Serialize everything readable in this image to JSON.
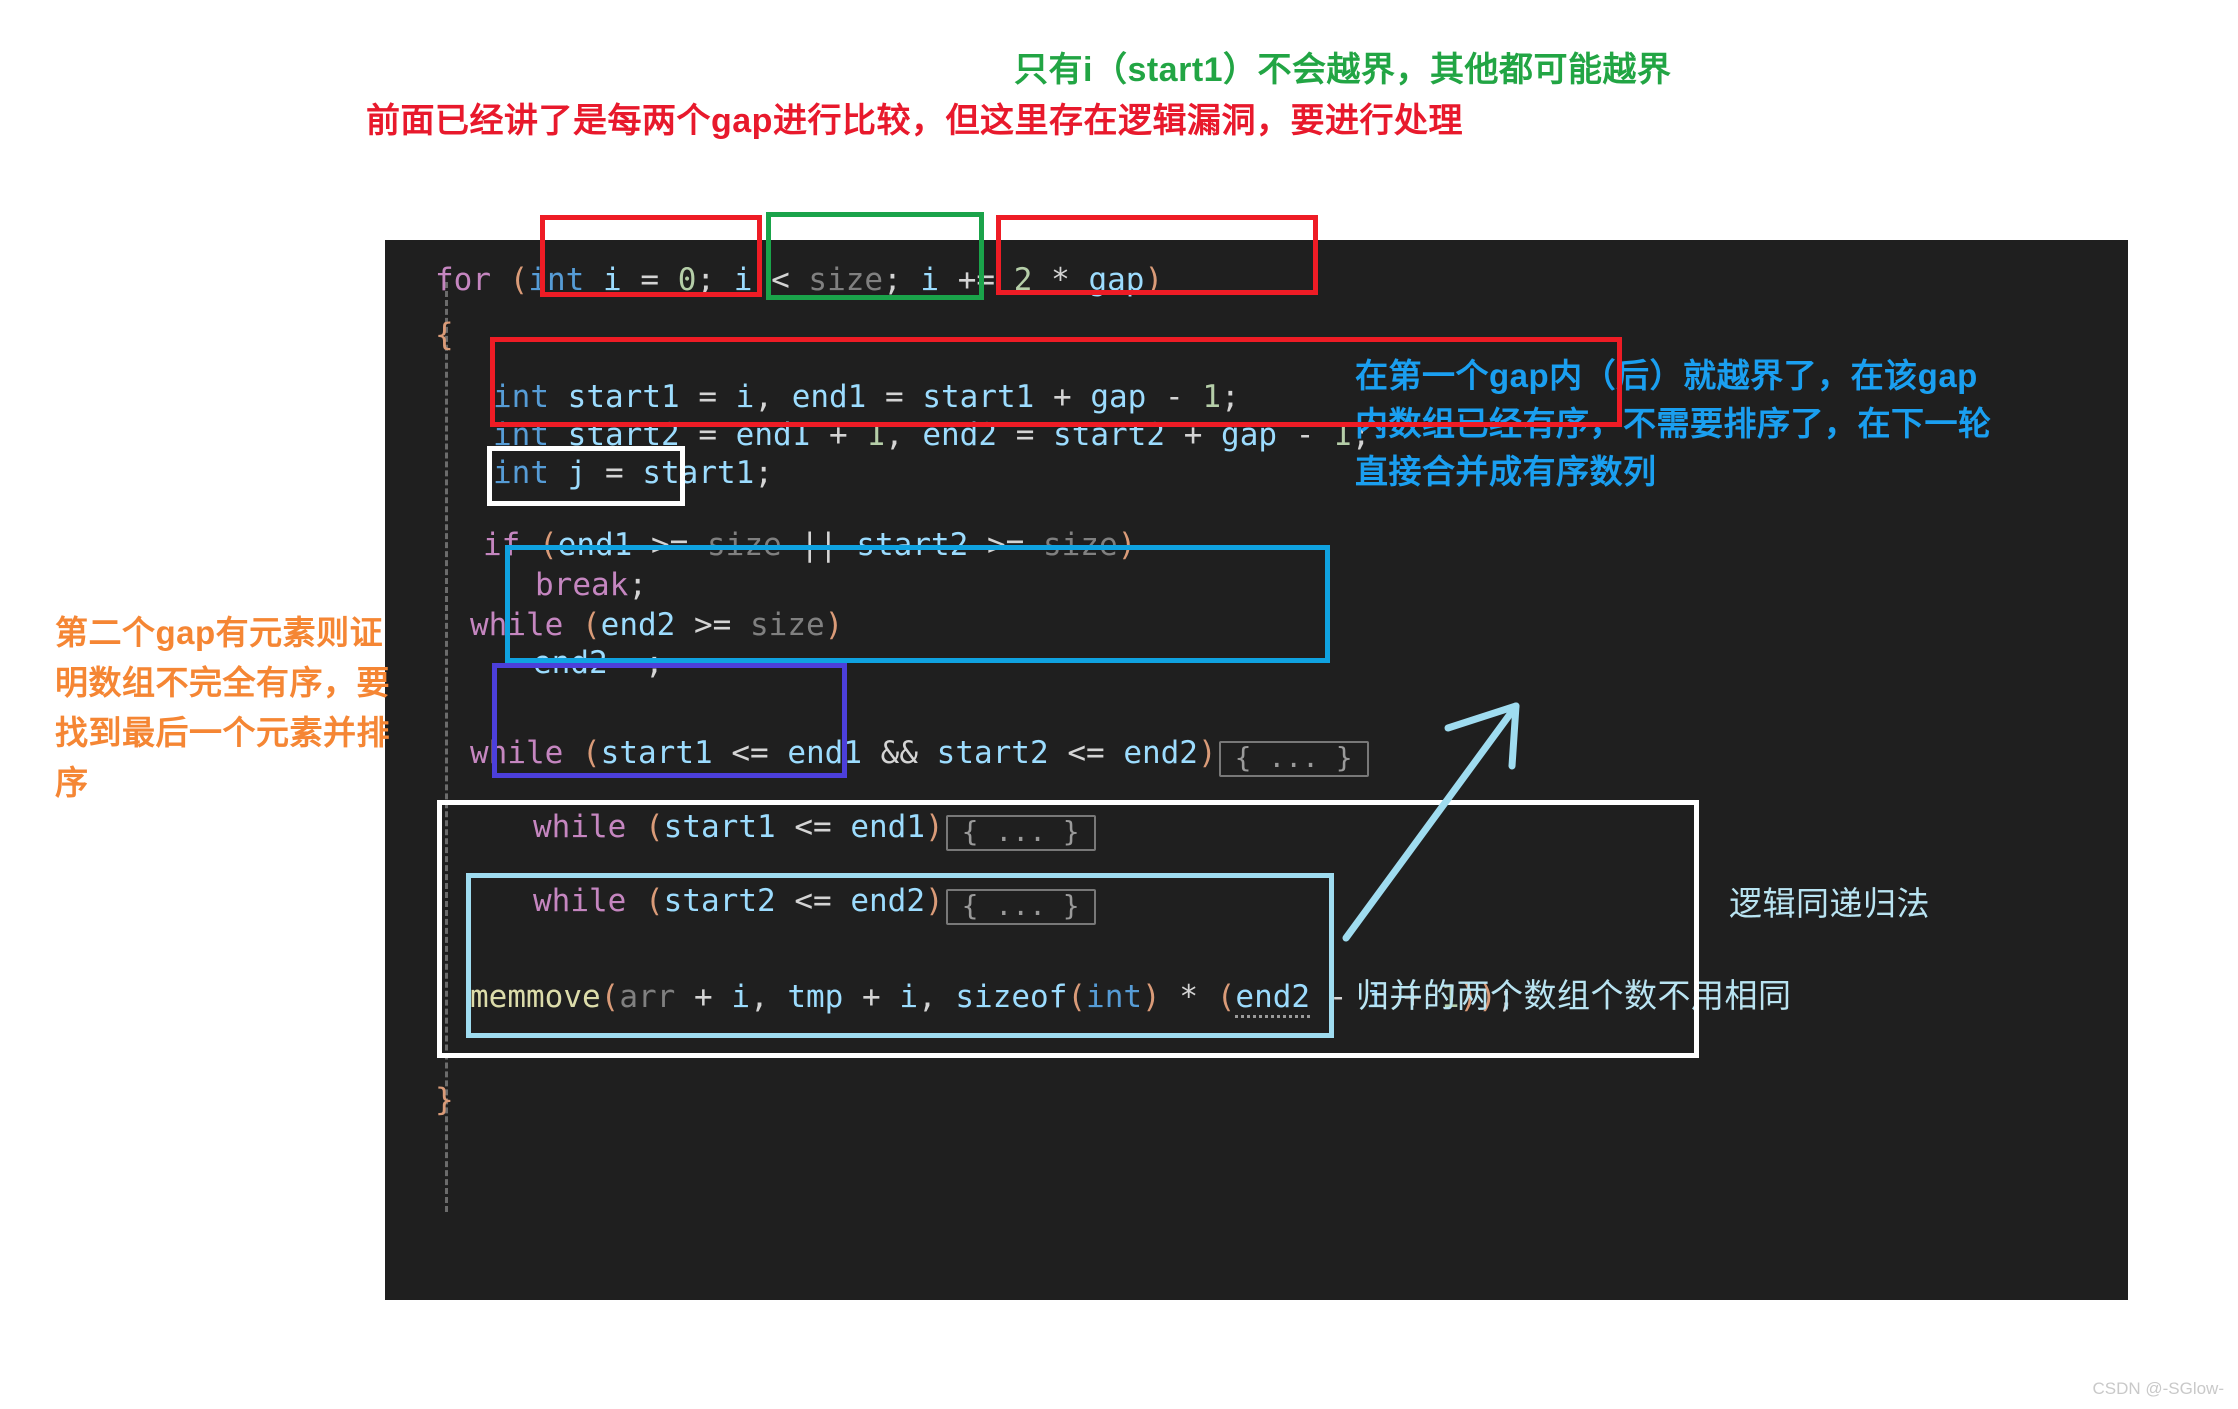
{
  "annotations": {
    "top_green": "只有i（start1）不会越界，其他都可能越界",
    "top_red": "前面已经讲了是每两个gap进行比较，但这里存在逻辑漏洞，要进行处理",
    "left_orange": "第二个gap有元素则证明数组不完全有序，要找到最后一个元素并排序",
    "right_blue": "在第一个gap内（后）就越界了，在该gap内数组已经有序，不需要排序了，在下一轮直接合并成有序数列",
    "right_lightblue_1": "逻辑同递归法",
    "right_lightblue_2": "归并的两个数组个数不用相同"
  },
  "code": {
    "language": "c",
    "lines": [
      {
        "id": "for-header",
        "text": "for (int i = 0; i < size; i += 2 * gap)"
      },
      {
        "id": "open-brace",
        "text": "{"
      },
      {
        "id": "decl-1",
        "text": "int start1 = i, end1 = start1 + gap - 1;"
      },
      {
        "id": "decl-2",
        "text": "int start2 = end1 + 1, end2 = start2 + gap - 1;"
      },
      {
        "id": "decl-j",
        "text": "int j = start1;"
      },
      {
        "id": "if-bound",
        "text": "if (end1 >= size || start2 >= size)"
      },
      {
        "id": "break",
        "text": "break;"
      },
      {
        "id": "while-end2",
        "text": "while (end2 >= size)"
      },
      {
        "id": "end2-dec",
        "text": "end2--;"
      },
      {
        "id": "while-merge",
        "text": "while (start1 <= end1 && start2 <= end2)",
        "fold": "{ ... }"
      },
      {
        "id": "while-rest1",
        "text": "while (start1 <= end1)",
        "fold": "{ ... }"
      },
      {
        "id": "while-rest2",
        "text": "while (start2 <= end2)",
        "fold": "{ ... }"
      },
      {
        "id": "memmove",
        "text": "memmove(arr + i, tmp + i, sizeof(int) * (end2 - i + 1));"
      },
      {
        "id": "close-brace",
        "text": "}"
      }
    ],
    "fold_marker": "{ ... }"
  },
  "highlight_boxes": [
    {
      "id": "init-clause",
      "color": "#ee1c25",
      "label": "red"
    },
    {
      "id": "cond-clause",
      "color": "#1aa34a",
      "label": "green"
    },
    {
      "id": "incr-clause",
      "color": "#ee1c25",
      "label": "red"
    },
    {
      "id": "decl-pair",
      "color": "#ee1c25",
      "label": "red"
    },
    {
      "id": "decl-j",
      "color": "#ffffff",
      "label": "white"
    },
    {
      "id": "if-bound",
      "color": "#0fa2e0",
      "label": "cyan"
    },
    {
      "id": "while-end2",
      "color": "#4c3fdb",
      "label": "purple"
    },
    {
      "id": "merge-outer",
      "color": "#ffffff",
      "label": "white"
    },
    {
      "id": "merge-inner",
      "color": "#9fdcf0",
      "label": "light-blue"
    }
  ],
  "watermark": "CSDN @-SGlow-"
}
